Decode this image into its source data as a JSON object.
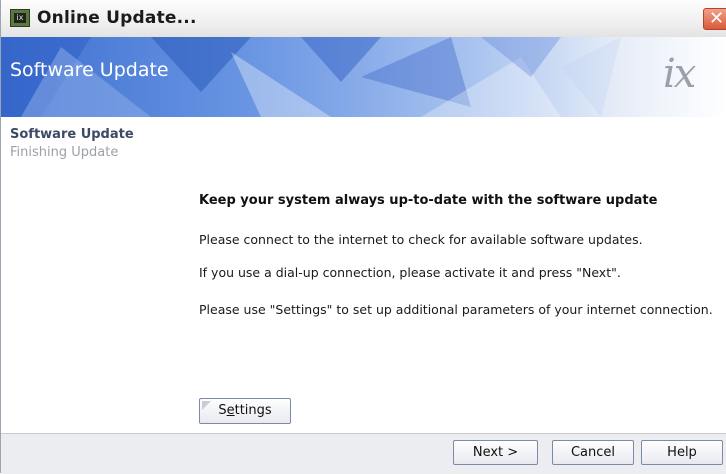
{
  "window": {
    "title": "Online Update...",
    "app_icon_label": "ix"
  },
  "banner": {
    "title": "Software Update",
    "logo_text": "ix"
  },
  "steps": [
    {
      "label": "Software Update",
      "active": true
    },
    {
      "label": "Finishing Update",
      "active": false
    }
  ],
  "content": {
    "heading": "Keep your system always up-to-date with the software update",
    "lines": [
      "Please connect to the internet to check for available software updates.",
      "If you use a dial-up connection, please activate it and press \"Next\".",
      "Please use \"Settings\" to set up additional parameters of your internet connection."
    ],
    "settings_button": {
      "before": "S",
      "underlined": "e",
      "after": "ttings"
    }
  },
  "footer": {
    "next_label": "Next >",
    "cancel_label": "Cancel",
    "help_label": "Help"
  },
  "colors": {
    "banner_blue": "#3d6fd0",
    "step_title": "#3c4a66",
    "close_red": "#d95a3a"
  }
}
